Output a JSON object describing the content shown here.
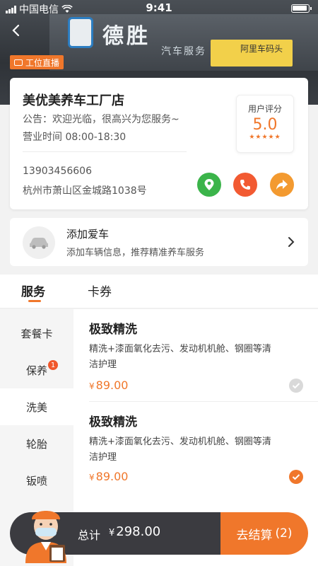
{
  "status_bar": {
    "carrier": "中国电信",
    "time": "9:41"
  },
  "header": {
    "live_tag": "工位直播"
  },
  "store": {
    "name": "美优美养车工厂店",
    "notice": "公告：欢迎光临，很高兴为您服务~",
    "hours": "营业时间 08:00-18:30",
    "phone": "13903456606",
    "address": "杭州市萧山区金城路1038号",
    "rating_label": "用户评分",
    "rating_value": "5.0",
    "stars": "★★★★★",
    "rating": 5
  },
  "car": {
    "title": "添加爱车",
    "subtitle": "添加车辆信息，推荐精准养车服务"
  },
  "tabs": [
    {
      "label": "服务",
      "active": true
    },
    {
      "label": "卡券",
      "active": false
    }
  ],
  "categories": [
    {
      "label": "套餐卡",
      "active": false,
      "badge": ""
    },
    {
      "label": "保养",
      "active": false,
      "badge": "1"
    },
    {
      "label": "洗美",
      "active": true,
      "badge": ""
    },
    {
      "label": "轮胎",
      "active": false,
      "badge": ""
    },
    {
      "label": "钣喷",
      "active": false,
      "badge": ""
    }
  ],
  "services": [
    {
      "title": "极致精洗",
      "desc": "精洗+漆面氧化去污、发动机机舱、钢圈等清洁护理",
      "currency": "¥",
      "price": "89.00",
      "selected": false
    },
    {
      "title": "极致精洗",
      "desc": "精洗+漆面氧化去污、发动机机舱、钢圈等清洁护理",
      "currency": "¥",
      "price": "89.00",
      "selected": true
    }
  ],
  "cart": {
    "total_label": "总计",
    "currency": "¥",
    "total": "298.00",
    "checkout_label": "去结算",
    "count": "(2)"
  },
  "colors": {
    "accent": "#f0772b",
    "map": "#3bb44a",
    "call": "#f25a32",
    "share": "#f39a30",
    "bar": "#3b3b40"
  }
}
